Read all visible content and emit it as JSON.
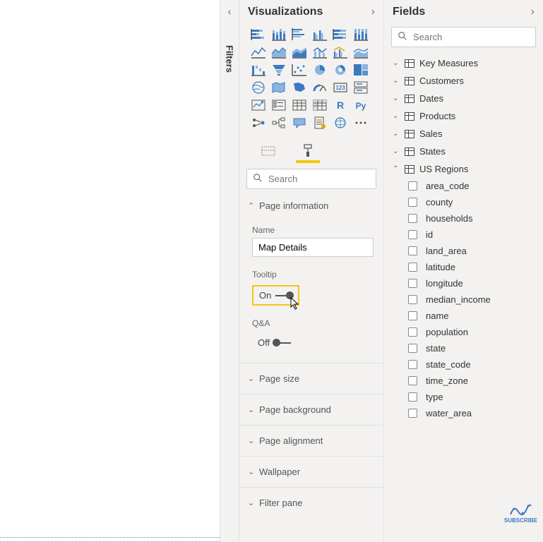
{
  "filters": {
    "label": "Filters"
  },
  "viz_pane": {
    "title": "Visualizations",
    "search_placeholder": "Search",
    "tabs": {
      "fields": "fields",
      "format": "format"
    },
    "sections": {
      "page_info": {
        "label": "Page information",
        "name_label": "Name",
        "name_value": "Map Details",
        "tooltip_label": "Tooltip",
        "tooltip_state": "On",
        "qa_label": "Q&A",
        "qa_state": "Off"
      },
      "page_size": {
        "label": "Page size"
      },
      "page_background": {
        "label": "Page background"
      },
      "page_alignment": {
        "label": "Page alignment"
      },
      "wallpaper": {
        "label": "Wallpaper"
      },
      "filter_pane": {
        "label": "Filter pane"
      }
    }
  },
  "fields_pane": {
    "title": "Fields",
    "search_placeholder": "Search",
    "tables": [
      {
        "name": "Key Measures",
        "expanded": false,
        "icon": "measure"
      },
      {
        "name": "Customers",
        "expanded": false,
        "icon": "table"
      },
      {
        "name": "Dates",
        "expanded": false,
        "icon": "table"
      },
      {
        "name": "Products",
        "expanded": false,
        "icon": "table"
      },
      {
        "name": "Sales",
        "expanded": false,
        "icon": "table"
      },
      {
        "name": "States",
        "expanded": false,
        "icon": "table"
      },
      {
        "name": "US Regions",
        "expanded": true,
        "icon": "table",
        "fields": [
          "area_code",
          "county",
          "households",
          "id",
          "land_area",
          "latitude",
          "longitude",
          "median_income",
          "name",
          "population",
          "state",
          "state_code",
          "time_zone",
          "type",
          "water_area"
        ]
      }
    ]
  },
  "watermark": "SUBSCRIBE"
}
